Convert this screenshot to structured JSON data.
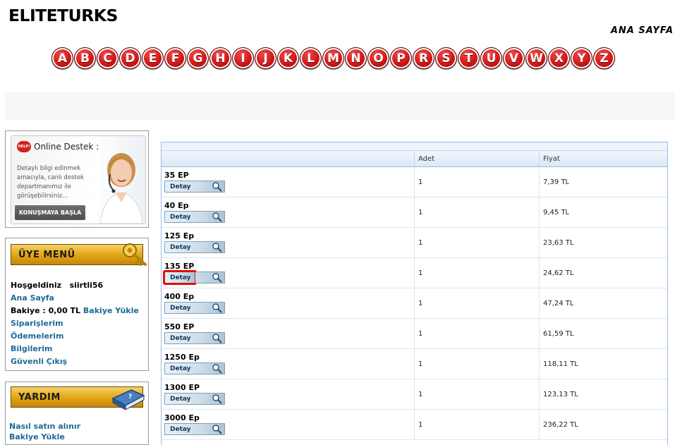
{
  "site": {
    "logo": "ELITETURKS",
    "home_link": "ANA SAYFA"
  },
  "alphabet": [
    "A",
    "B",
    "C",
    "D",
    "E",
    "F",
    "G",
    "H",
    "I",
    "J",
    "K",
    "L",
    "M",
    "N",
    "O",
    "P",
    "R",
    "S",
    "T",
    "U",
    "V",
    "W",
    "X",
    "Y",
    "Z"
  ],
  "support": {
    "badge": "HELP!",
    "title": "Online Destek :",
    "text": "Detaylı bilgi edinmek amacıyla, canlı destek departmanımız ile görüşebilirsiniz...",
    "button": "KONUŞMAYA BAŞLA"
  },
  "member_menu": {
    "banner": "ÜYE MENÜ",
    "welcome_label": "Hoşgeldiniz",
    "username": "siirtli56",
    "home": "Ana Sayfa",
    "balance_label": "Bakiye : 0,00 TL",
    "balance_load": "Bakiye Yükle",
    "orders": "Siparişlerim",
    "payments": "Ödemelerim",
    "info": "Bilgilerim",
    "logout": "Güvenli Çıkış"
  },
  "help_menu": {
    "banner": "YARDIM",
    "items": [
      "Nasıl satın alınır",
      "Bakiye Yükle"
    ]
  },
  "table": {
    "headers": [
      "",
      "Adet",
      "Fiyat"
    ],
    "detail_label": "Detay",
    "rows": [
      {
        "name": "35 EP",
        "qty": "1",
        "price": "7,39 TL"
      },
      {
        "name": "40 Ep",
        "qty": "1",
        "price": "9,45 TL"
      },
      {
        "name": "125 Ep",
        "qty": "1",
        "price": "23,63 TL"
      },
      {
        "name": "135 EP",
        "qty": "1",
        "price": "24,62 TL"
      },
      {
        "name": "400 Ep",
        "qty": "1",
        "price": "47,24 TL"
      },
      {
        "name": "550 EP",
        "qty": "1",
        "price": "61,59 TL"
      },
      {
        "name": "1250 Ep",
        "qty": "1",
        "price": "118,11 TL"
      },
      {
        "name": "1300 EP",
        "qty": "1",
        "price": "123,13 TL"
      },
      {
        "name": "3000 Ep",
        "qty": "1",
        "price": "236,22 TL"
      }
    ]
  }
}
